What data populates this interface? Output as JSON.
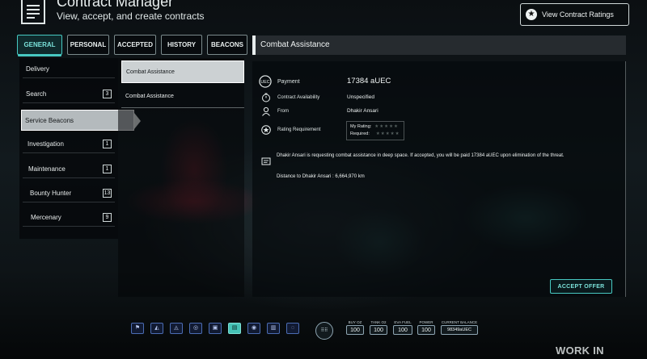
{
  "header": {
    "title": "Contract Manager",
    "subtitle": "View, accept, and create contracts",
    "rating_button": "View Contract Ratings"
  },
  "tabs": [
    {
      "label": "GENERAL",
      "active": true
    },
    {
      "label": "PERSONAL",
      "active": false
    },
    {
      "label": "ACCEPTED",
      "active": false
    },
    {
      "label": "HISTORY",
      "active": false
    },
    {
      "label": "BEACONS",
      "active": false
    }
  ],
  "categories": [
    {
      "label": "Delivery",
      "count": ""
    },
    {
      "label": "Search",
      "count": "3"
    },
    {
      "label": "Service Beacons",
      "count": "",
      "active": true
    },
    {
      "label": "Investigation",
      "count": "1"
    },
    {
      "label": "Maintenance",
      "count": "1"
    },
    {
      "label": "Bounty Hunter",
      "count": "13"
    },
    {
      "label": "Mercenary",
      "count": "9"
    }
  ],
  "contracts": [
    {
      "label": "Combat Assistance",
      "active": true
    },
    {
      "label": "Combat Assistance",
      "active": false
    }
  ],
  "detail": {
    "title": "Combat Assistance",
    "payment_label": "Payment",
    "payment_value": "17384 aUEC",
    "availability_label": "Contract Availability",
    "availability_value": "Unspecified",
    "from_label": "From",
    "from_value": "Dhakir Ansari",
    "rating_label": "Rating Requirement",
    "my_rating_label": "My Rating:",
    "required_label": "Required:",
    "my_rating_stars": 0,
    "required_stars": 0,
    "description": "Dhakir Ansari is requesting combat assistance in deep space. If accepted, you will be paid 17384 aUEC upon elimination of the threat.",
    "distance": "Distance to Dhakir Ansari : 6,664,970 km",
    "accept_button": "ACCEPT OFFER"
  },
  "bottom_bar": {
    "mfd_icons": [
      "crew-icon",
      "nav-icon",
      "quantum-icon",
      "fuel-icon",
      "cargo-icon",
      "contracts-icon",
      "weapons-icon",
      "comms-icon",
      "scan-icon"
    ],
    "mfd_active_index": 5,
    "stats": [
      {
        "label": "BUY OZ",
        "value": "100"
      },
      {
        "label": "TANK O2",
        "value": "100"
      },
      {
        "label": "EVA FUEL",
        "value": "100"
      },
      {
        "label": "POWER",
        "value": "100"
      },
      {
        "label": "CURRENT BALANCE",
        "value": "98349aUEC"
      }
    ]
  },
  "watermark": "WORK IN PROGRESS",
  "colors": {
    "accent": "#47c9c2",
    "accent_text": "#7be2da",
    "mfd_blue": "#4b6cb3"
  }
}
